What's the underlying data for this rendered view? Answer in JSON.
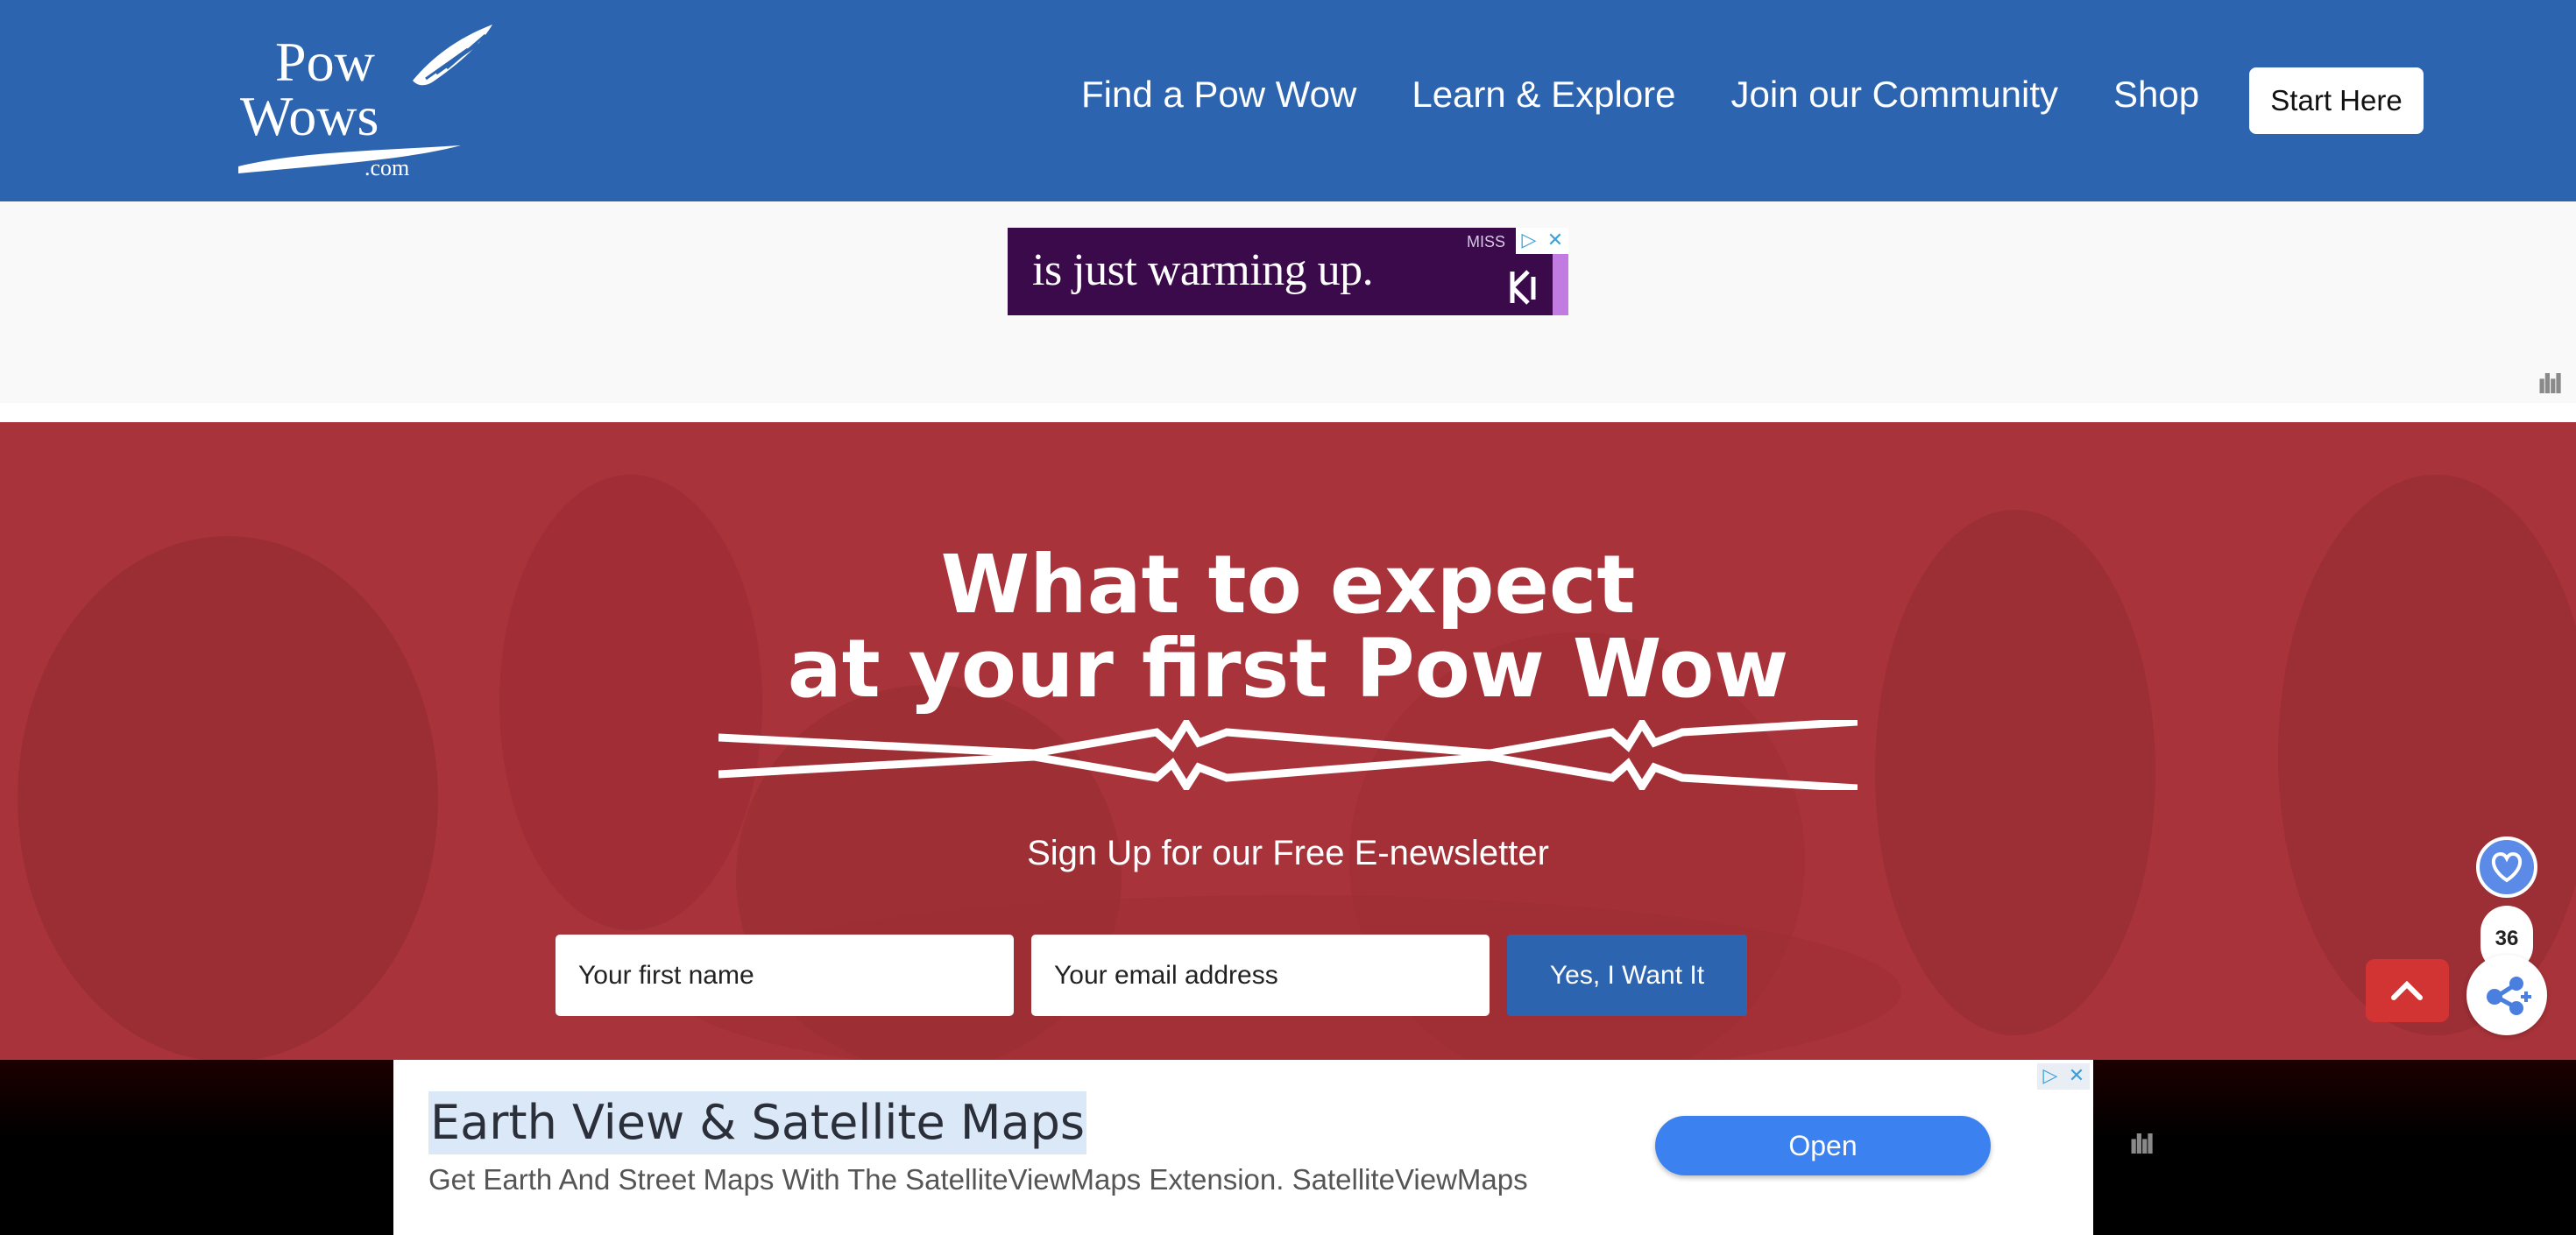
{
  "header": {
    "logo_alt": "PowWows.com",
    "nav": [
      {
        "label": "Find a Pow Wow"
      },
      {
        "label": "Learn & Explore"
      },
      {
        "label": "Join our Community"
      },
      {
        "label": "Shop"
      }
    ],
    "start_button": "Start Here"
  },
  "top_ad": {
    "text": "is just warming up.",
    "brand": "MISS",
    "choices_icon": "adchoices-icon",
    "close_icon": "close-icon"
  },
  "hero": {
    "title_line1": "What to expect",
    "title_line2": "at your first Pow Wow",
    "signup_label": "Sign Up for our Free E-newsletter",
    "first_name_placeholder": "Your first name",
    "email_placeholder": "Your email address",
    "submit_label": "Yes, I Want It",
    "colors": {
      "background": "#a9333a",
      "accent": "#2d64b0"
    }
  },
  "widgets": {
    "favorite_icon": "heart-icon",
    "count": "36",
    "share_icon": "share-icon",
    "back_to_top_icon": "chevron-up-icon"
  },
  "bottom_ad": {
    "headline": "Earth View & Satellite Maps",
    "subtext": "Get Earth And Street Maps With The SatelliteViewMaps Extension. SatelliteViewMaps",
    "button": "Open"
  }
}
